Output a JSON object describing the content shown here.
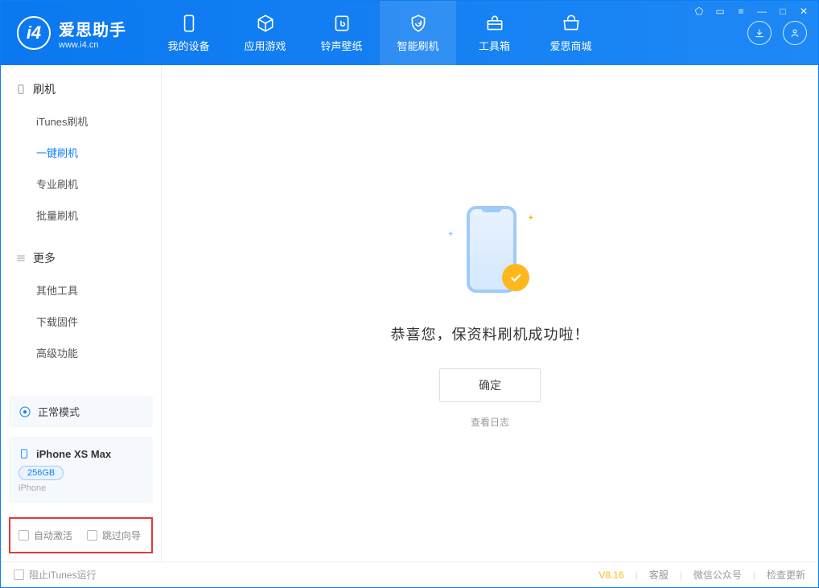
{
  "app": {
    "title": "爱思助手",
    "subtitle": "www.i4.cn"
  },
  "nav": {
    "device": "我的设备",
    "apps": "应用游戏",
    "ringtones": "铃声壁纸",
    "flash": "智能刷机",
    "toolbox": "工具箱",
    "store": "爱思商城"
  },
  "sidebar": {
    "section_flash": "刷机",
    "items_flash": {
      "itunes": "iTunes刷机",
      "onekey": "一键刷机",
      "pro": "专业刷机",
      "batch": "批量刷机"
    },
    "section_more": "更多",
    "items_more": {
      "other": "其他工具",
      "firmware": "下载固件",
      "advanced": "高级功能"
    },
    "mode": "正常模式",
    "device_name": "iPhone XS Max",
    "device_storage": "256GB",
    "device_type": "iPhone",
    "check_activate": "自动激活",
    "check_skip": "跳过向导"
  },
  "main": {
    "message": "恭喜您，保资料刷机成功啦！",
    "ok": "确定",
    "view_log": "查看日志"
  },
  "footer": {
    "block_itunes": "阻止iTunes运行",
    "version": "V8.16",
    "support": "客服",
    "wechat": "微信公众号",
    "update": "检查更新"
  }
}
